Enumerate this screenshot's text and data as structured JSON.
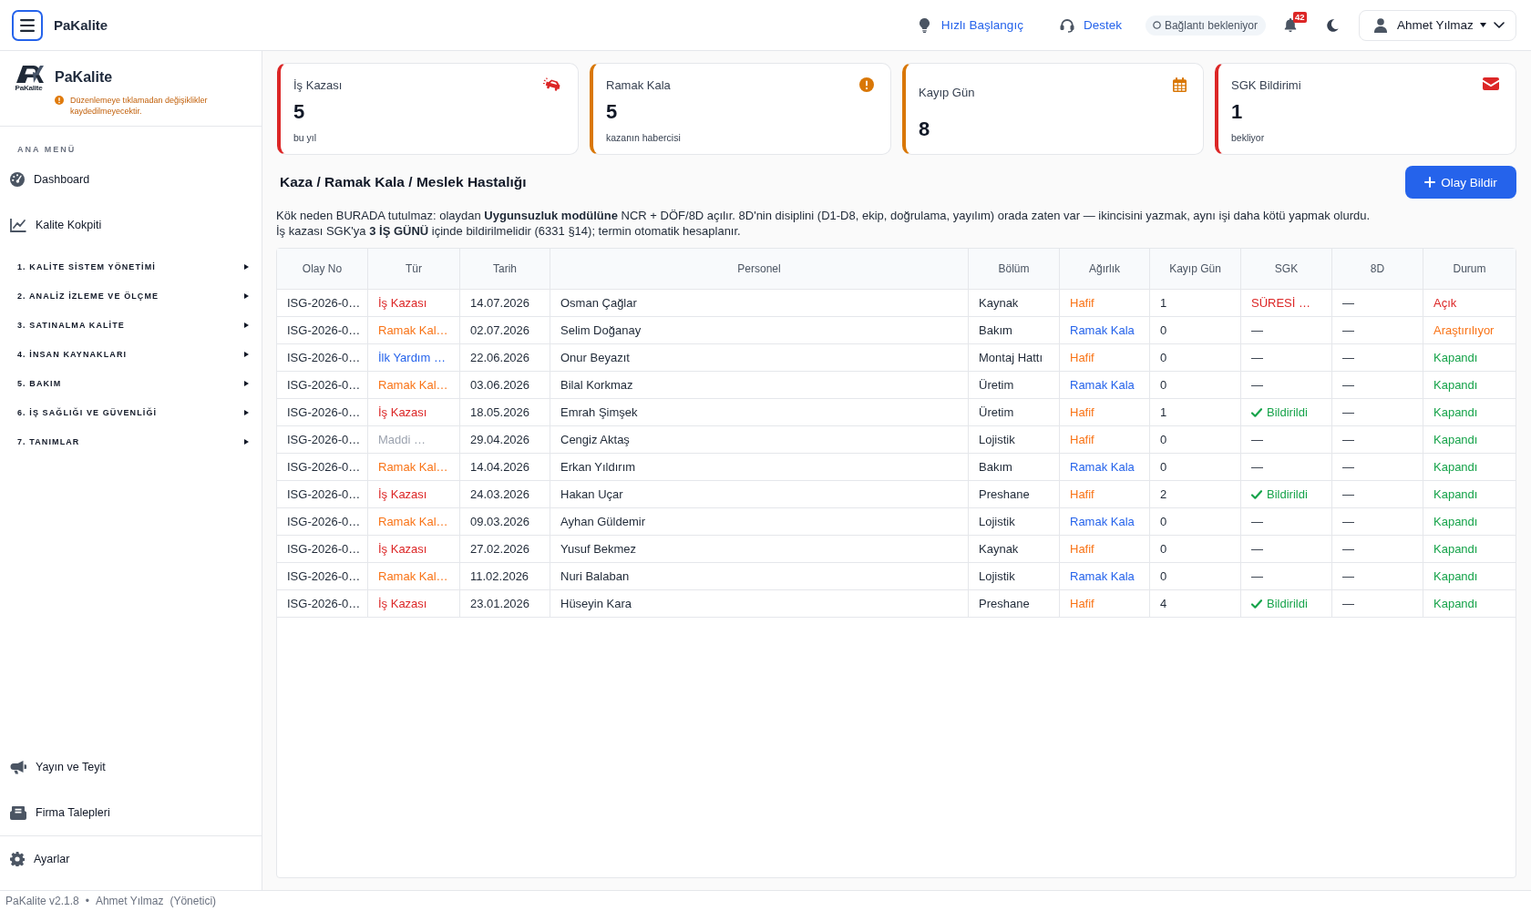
{
  "topbar": {
    "brand": "PaKalite",
    "quick_start": "Hızlı Başlangıç",
    "support": "Destek",
    "connection": "Bağlantı bekleniyor",
    "notifications": "42",
    "user": "Ahmet Yılmaz"
  },
  "sidebar": {
    "logo_caption": "PaKalite",
    "title": "PaKalite",
    "notice": "Düzenlemeye tıklamadan değişiklikler kaydedilmeyecektir.",
    "section_label": "ANA MENÜ",
    "items": [
      {
        "label": "Dashboard"
      },
      {
        "label": "Kalite Kokpiti"
      }
    ],
    "groups": [
      {
        "label": "1. KALİTE SİSTEM YÖNETİMİ",
        "expanded": false
      },
      {
        "label": "2. ANALİZ İZLEME VE ÖLÇME",
        "expanded": false
      },
      {
        "label": "3. SATINALMA KALİTE",
        "expanded": false
      },
      {
        "label": "4. İNSAN KAYNAKLARI",
        "expanded": false
      },
      {
        "label": "5. BAKIM",
        "expanded": false
      },
      {
        "label": "6. İŞ SAĞLIĞI VE GÜVENLİĞİ",
        "expanded": false
      },
      {
        "label": "7. TANIMLAR",
        "expanded": false
      }
    ],
    "bottom_items": [
      {
        "label": "Yayın ve Teyit"
      },
      {
        "label": "Firma Talepleri"
      }
    ],
    "settings": "Ayarlar"
  },
  "stats": [
    {
      "title": "İş Kazası",
      "value": "5",
      "note": "bu yıl",
      "color": "#dc2626"
    },
    {
      "title": "Ramak Kala",
      "value": "5",
      "note": "kazanın habercisi",
      "color": "#d97706"
    },
    {
      "title": "Kayıp Gün",
      "value": "8",
      "color": "#d97706"
    },
    {
      "title": "SGK Bildirimi",
      "value": "1",
      "note": "bekliyor",
      "color": "#dc2626"
    }
  ],
  "page": {
    "title": "Kaza / Ramak Kala / Meslek Hastalığı",
    "action": "Olay Bildir",
    "notes": [
      "Kök neden BURADA tutulmaz: olaydan **Uygunsuzluk modülüne** NCR + DÖF/8D açılır. 8D'nin disiplini (D1-D8, ekip, doğrulama, yayılım) orada zaten var — ikincisini yazmak, aynı işi daha kötü yapmak olurdu.",
      "İş kazası SGK'ya **3 İŞ GÜNÜ** içinde bildirilmelidir (6331 §14); termin otomatik hesaplanır."
    ]
  },
  "table": {
    "columns": [
      "Olay No",
      "Tür",
      "Tarih",
      "Personel",
      "Bölüm",
      "Ağırlık",
      "Kayıp Gün",
      "SGK",
      "8D",
      "Durum"
    ],
    "rows": [
      {
        "olay_no": "ISG-2026-0…",
        "tur": {
          "text": "İş Kazası",
          "color": "#dc2626"
        },
        "tarih": "14.07.2026",
        "personel": "Osman Çağlar",
        "bolum": "Kaynak",
        "agirlik": {
          "text": "Hafif",
          "color": "#f97316"
        },
        "kayip_gun": "1",
        "sgk": {
          "text": "SÜRESİ …",
          "color": "#dc2626",
          "done": false
        },
        "d8": "—",
        "durum": {
          "text": "Açık",
          "color": "#dc2626"
        }
      },
      {
        "olay_no": "ISG-2026-0…",
        "tur": {
          "text": "Ramak Kal…",
          "color": "#f97316"
        },
        "tarih": "02.07.2026",
        "personel": "Selim Doğanay",
        "bolum": "Bakım",
        "agirlik": {
          "text": "Ramak Kala",
          "color": "#2563eb"
        },
        "kayip_gun": "0",
        "sgk": {
          "text": "—",
          "done": false
        },
        "d8": "—",
        "durum": {
          "text": "Araştırılıyor",
          "color": "#f97316"
        }
      },
      {
        "olay_no": "ISG-2026-0…",
        "tur": {
          "text": "İlk Yardım …",
          "color": "#2563eb"
        },
        "tarih": "22.06.2026",
        "personel": "Onur Beyazıt",
        "bolum": "Montaj Hattı",
        "agirlik": {
          "text": "Hafif",
          "color": "#f97316"
        },
        "kayip_gun": "0",
        "sgk": {
          "text": "—",
          "done": false
        },
        "d8": "—",
        "durum": {
          "text": "Kapandı",
          "color": "#16a34a"
        }
      },
      {
        "olay_no": "ISG-2026-0…",
        "tur": {
          "text": "Ramak Kal…",
          "color": "#f97316"
        },
        "tarih": "03.06.2026",
        "personel": "Bilal Korkmaz",
        "bolum": "Üretim",
        "agirlik": {
          "text": "Ramak Kala",
          "color": "#2563eb"
        },
        "kayip_gun": "0",
        "sgk": {
          "text": "—",
          "done": false
        },
        "d8": "—",
        "durum": {
          "text": "Kapandı",
          "color": "#16a34a"
        }
      },
      {
        "olay_no": "ISG-2026-0…",
        "tur": {
          "text": "İş Kazası",
          "color": "#dc2626"
        },
        "tarih": "18.05.2026",
        "personel": "Emrah Şimşek",
        "bolum": "Üretim",
        "agirlik": {
          "text": "Hafif",
          "color": "#f97316"
        },
        "kayip_gun": "1",
        "sgk": {
          "text": "Bildirildi",
          "color": "#16a34a",
          "done": true
        },
        "d8": "—",
        "durum": {
          "text": "Kapandı",
          "color": "#16a34a"
        }
      },
      {
        "olay_no": "ISG-2026-0…",
        "tur": {
          "text": "Maddi …",
          "color": "#9ca3af"
        },
        "tarih": "29.04.2026",
        "personel": "Cengiz Aktaş",
        "bolum": "Lojistik",
        "agirlik": {
          "text": "Hafif",
          "color": "#f97316"
        },
        "kayip_gun": "0",
        "sgk": {
          "text": "—",
          "done": false
        },
        "d8": "—",
        "durum": {
          "text": "Kapandı",
          "color": "#16a34a"
        }
      },
      {
        "olay_no": "ISG-2026-0…",
        "tur": {
          "text": "Ramak Kal…",
          "color": "#f97316"
        },
        "tarih": "14.04.2026",
        "personel": "Erkan Yıldırım",
        "bolum": "Bakım",
        "agirlik": {
          "text": "Ramak Kala",
          "color": "#2563eb"
        },
        "kayip_gun": "0",
        "sgk": {
          "text": "—",
          "done": false
        },
        "d8": "—",
        "durum": {
          "text": "Kapandı",
          "color": "#16a34a"
        }
      },
      {
        "olay_no": "ISG-2026-0…",
        "tur": {
          "text": "İş Kazası",
          "color": "#dc2626"
        },
        "tarih": "24.03.2026",
        "personel": "Hakan Uçar",
        "bolum": "Preshane",
        "agirlik": {
          "text": "Hafif",
          "color": "#f97316"
        },
        "kayip_gun": "2",
        "sgk": {
          "text": "Bildirildi",
          "color": "#16a34a",
          "done": true
        },
        "d8": "—",
        "durum": {
          "text": "Kapandı",
          "color": "#16a34a"
        }
      },
      {
        "olay_no": "ISG-2026-0…",
        "tur": {
          "text": "Ramak Kal…",
          "color": "#f97316"
        },
        "tarih": "09.03.2026",
        "personel": "Ayhan Güldemir",
        "bolum": "Lojistik",
        "agirlik": {
          "text": "Ramak Kala",
          "color": "#2563eb"
        },
        "kayip_gun": "0",
        "sgk": {
          "text": "—",
          "done": false
        },
        "d8": "—",
        "durum": {
          "text": "Kapandı",
          "color": "#16a34a"
        }
      },
      {
        "olay_no": "ISG-2026-0…",
        "tur": {
          "text": "İş Kazası",
          "color": "#dc2626"
        },
        "tarih": "27.02.2026",
        "personel": "Yusuf Bekmez",
        "bolum": "Kaynak",
        "agirlik": {
          "text": "Hafif",
          "color": "#f97316"
        },
        "kayip_gun": "0",
        "sgk": {
          "text": "—",
          "done": false
        },
        "d8": "—",
        "durum": {
          "text": "Kapandı",
          "color": "#16a34a"
        }
      },
      {
        "olay_no": "ISG-2026-0…",
        "tur": {
          "text": "Ramak Kal…",
          "color": "#f97316"
        },
        "tarih": "11.02.2026",
        "personel": "Nuri Balaban",
        "bolum": "Lojistik",
        "agirlik": {
          "text": "Ramak Kala",
          "color": "#2563eb"
        },
        "kayip_gun": "0",
        "sgk": {
          "text": "—",
          "done": false
        },
        "d8": "—",
        "durum": {
          "text": "Kapandı",
          "color": "#16a34a"
        }
      },
      {
        "olay_no": "ISG-2026-0…",
        "tur": {
          "text": "İş Kazası",
          "color": "#dc2626"
        },
        "tarih": "23.01.2026",
        "personel": "Hüseyin Kara",
        "bolum": "Preshane",
        "agirlik": {
          "text": "Hafif",
          "color": "#f97316"
        },
        "kayip_gun": "4",
        "sgk": {
          "text": "Bildirildi",
          "color": "#16a34a",
          "done": true
        },
        "d8": "—",
        "durum": {
          "text": "Kapandı",
          "color": "#16a34a"
        }
      }
    ]
  },
  "footer": {
    "version": "PaKalite v2.1.8",
    "separator": "•",
    "user": "Ahmet Yılmaz",
    "role": "(Yönetici)"
  }
}
